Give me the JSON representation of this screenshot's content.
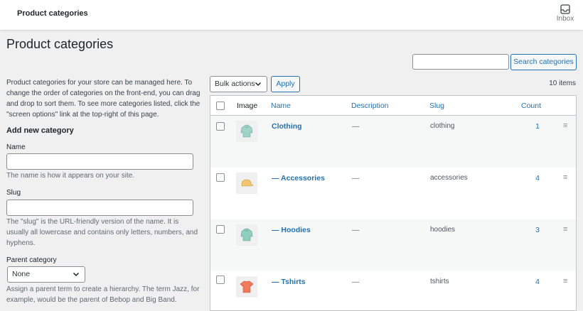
{
  "topbar": {
    "title": "Product categories",
    "inbox_label": "Inbox"
  },
  "page": {
    "title": "Product categories"
  },
  "search": {
    "placeholder": "",
    "button_label": "Search categories"
  },
  "form": {
    "intro": "Product categories for your store can be managed here. To change the order of categories on the front-end, you can drag and drop to sort them. To see more categories listed, click the \"screen options\" link at the top-right of this page.",
    "heading": "Add new category",
    "name_label": "Name",
    "name_value": "",
    "name_help": "The name is how it appears on your site.",
    "slug_label": "Slug",
    "slug_value": "",
    "slug_help": "The \"slug\" is the URL-friendly version of the name. It is usually all lowercase and contains only letters, numbers, and hyphens.",
    "parent_label": "Parent category",
    "parent_selected": "None",
    "parent_help": "Assign a parent term to create a hierarchy. The term Jazz, for example, would be the parent of Bebop and Big Band."
  },
  "table_controls": {
    "bulk_selected": "Bulk actions",
    "apply_label": "Apply",
    "items_count": "10 items"
  },
  "table": {
    "headers": {
      "image": "Image",
      "name": "Name",
      "description": "Description",
      "slug": "Slug",
      "count": "Count"
    },
    "rows": [
      {
        "name": "Clothing",
        "description": "—",
        "slug": "clothing",
        "count": "1",
        "icon": "hoodie-icon",
        "color": "#9fd3c7"
      },
      {
        "name": "— Accessories",
        "description": "—",
        "slug": "accessories",
        "count": "4",
        "icon": "cap-icon",
        "color": "#f2c572"
      },
      {
        "name": "— Hoodies",
        "description": "—",
        "slug": "hoodies",
        "count": "3",
        "icon": "hoodie-icon",
        "color": "#8fcfc0"
      },
      {
        "name": "— Tshirts",
        "description": "—",
        "slug": "tshirts",
        "count": "4",
        "icon": "tshirt-icon",
        "color": "#f07a5e"
      }
    ]
  },
  "colors": {
    "accent": "#2271b1",
    "background": "#f0f0f1",
    "row_alt": "#f6f7f7"
  }
}
